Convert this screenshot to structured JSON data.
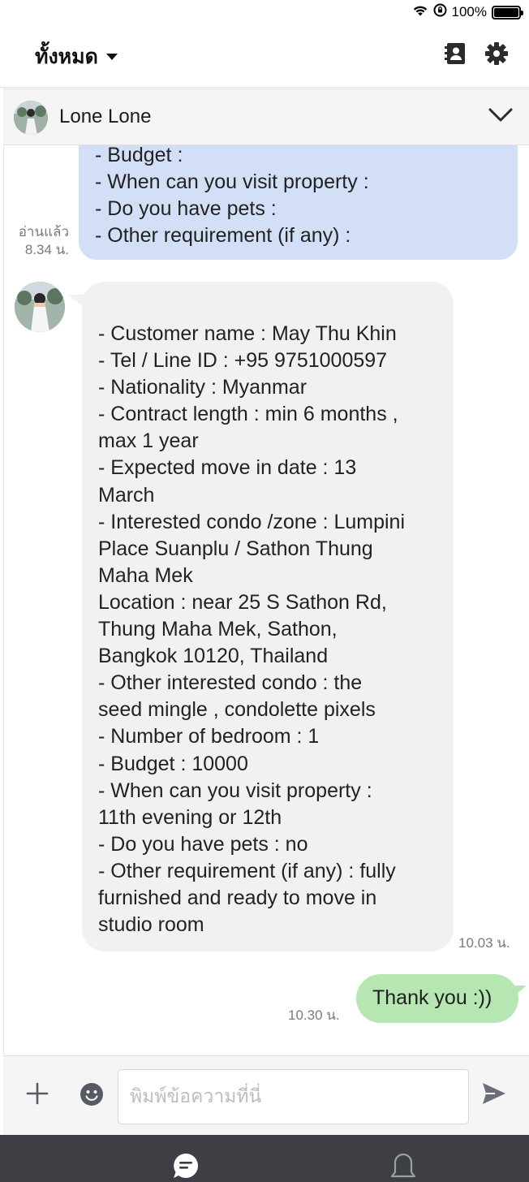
{
  "status_bar": {
    "battery_text": "100%",
    "battery_level": 1.0
  },
  "topbar": {
    "filter_label": "ทั้งหมด",
    "icons": [
      "contacts-icon",
      "gear-icon"
    ]
  },
  "chat_header": {
    "contact_name": "Lone Lone"
  },
  "messages": {
    "outgoing_form": {
      "lines": [
        "- Budget :",
        "- When can you visit property :",
        "- Do you have pets :",
        "- Other requirement (if any) :"
      ],
      "read_label": "อ่านแล้ว",
      "time": "8.34 น."
    },
    "incoming_reply": {
      "lines": [
        "- Customer name : May Thu Khin",
        "- Tel / Line ID : +95 9751000597",
        "- Nationality : Myanmar",
        "- Contract length : min 6 months ,",
        "max 1 year",
        "- Expected move in date : 13",
        "March",
        "- Interested condo /zone : Lumpini",
        "Place Suanplu / Sathon Thung",
        "Maha Mek",
        "Location : near  25 S Sathon Rd,",
        "Thung Maha Mek, Sathon,",
        "Bangkok 10120, Thailand",
        "- Other interested condo : the",
        "seed mingle , condolette pixels",
        "- Number of bedroom  : 1",
        "- Budget : 10000",
        "- When can you visit property :",
        "11th evening or 12th",
        "- Do you have pets : no",
        "- Other requirement (if any) : fully",
        "furnished and ready to move in",
        "studio room"
      ],
      "time": "10.03 น."
    },
    "outgoing_thanks": {
      "text": "Thank you :))",
      "time": "10.30 น."
    }
  },
  "composer": {
    "placeholder": "พิมพ์ข้อความที่นี่",
    "value": ""
  },
  "bottom_nav": {
    "items": [
      "chat-icon",
      "bell-icon"
    ]
  },
  "colors": {
    "outgoing_blue": "#d3dff7",
    "incoming_gray": "#f1f1f2",
    "outgoing_green": "#b6e7b3",
    "nav_bg": "#3d3f45"
  }
}
